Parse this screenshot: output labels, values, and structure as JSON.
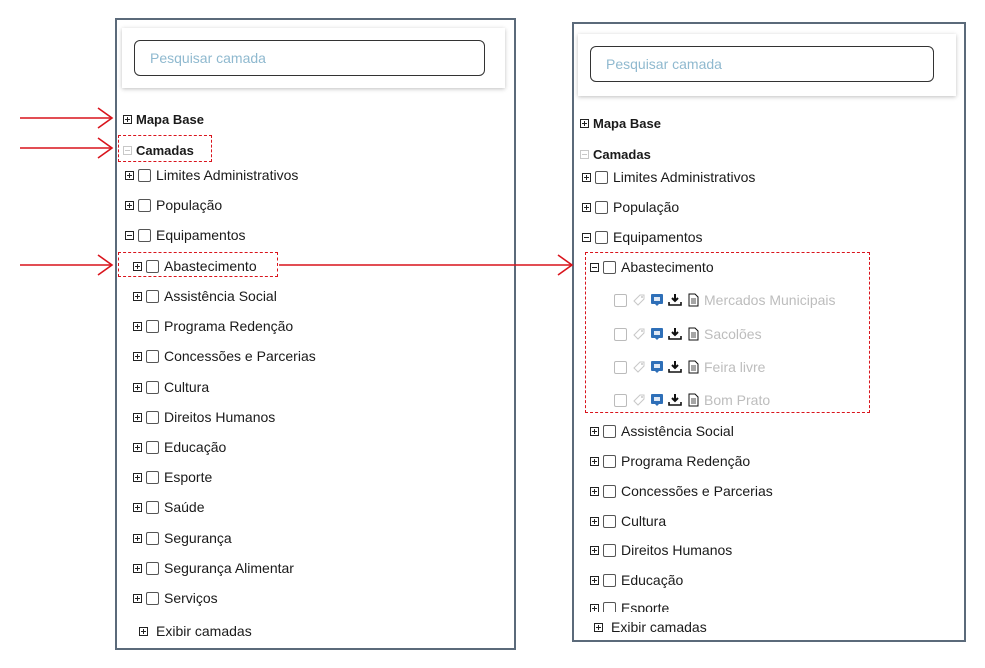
{
  "search": {
    "placeholder": "Pesquisar camada"
  },
  "tree": {
    "mapa_base": "Mapa Base",
    "camadas": "Camadas",
    "limites": "Limites Administrativos",
    "populacao": "População",
    "equipamentos": "Equipamentos",
    "abastecimento": "Abastecimento",
    "assistencia": "Assistência Social",
    "redencao": "Programa Redenção",
    "concessoes": "Concessões e Parcerias",
    "cultura": "Cultura",
    "direitos": "Direitos Humanos",
    "educacao": "Educação",
    "esporte": "Esporte",
    "saude": "Saúde",
    "seguranca": "Segurança",
    "seg_alimentar": "Segurança Alimentar",
    "servicos": "Serviços"
  },
  "abastecimento_items": [
    {
      "label": "Mercados Municipais"
    },
    {
      "label": "Sacolões"
    },
    {
      "label": "Feira livre"
    },
    {
      "label": "Bom Prato"
    }
  ],
  "footer": {
    "exibir_camadas": "Exibir camadas"
  },
  "colors": {
    "annotation": "#d9141c",
    "panel_border": "#5b6a7a",
    "placeholder": "#8fb9cf",
    "map_icon": "#2e6fb8"
  }
}
